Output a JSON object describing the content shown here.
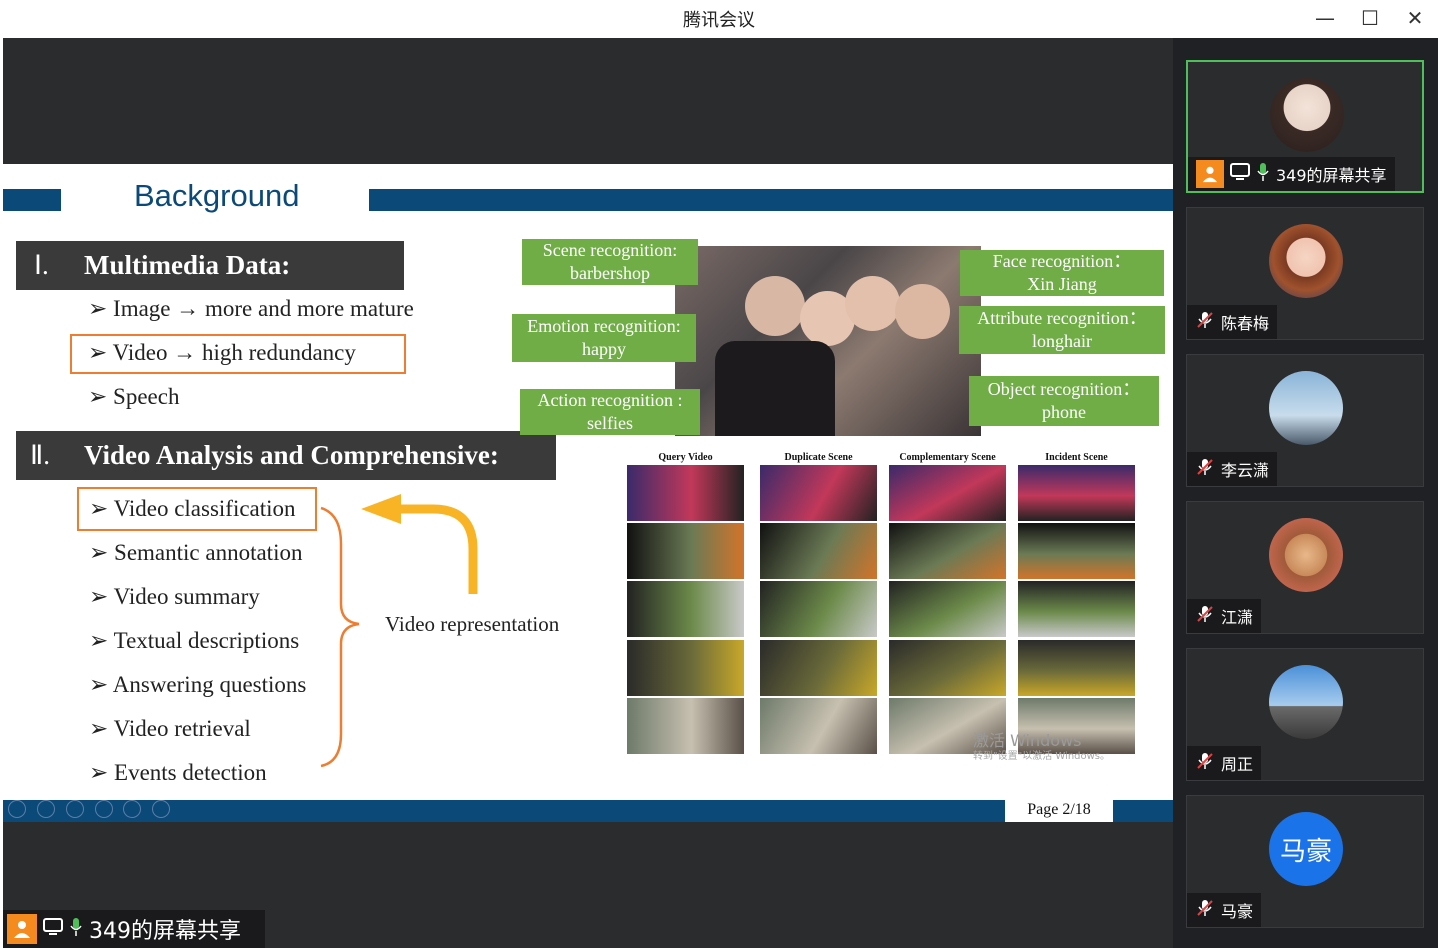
{
  "window": {
    "title": "腾讯会议",
    "minimize": "—",
    "maximize": "☐",
    "close": "✕"
  },
  "slide": {
    "title": "Background",
    "section1": {
      "numeral": "Ⅰ.",
      "heading": "Multimedia Data:"
    },
    "bullets1": [
      {
        "label": "Image",
        "arrow": "→",
        "rest": "more and more mature"
      },
      {
        "label": "Video",
        "arrow": "→",
        "rest": "high redundancy"
      },
      {
        "label": "Speech"
      }
    ],
    "section2": {
      "numeral": "Ⅱ.",
      "heading": "Video Analysis and Comprehensive:"
    },
    "bullets2": [
      "Video classification",
      "Semantic annotation",
      "Video summary",
      "Textual descriptions",
      "Answering questions",
      "Video retrieval",
      "Events detection"
    ],
    "video_representation": "Video representation",
    "labels": {
      "scene": [
        "Scene recognition:",
        "barbershop"
      ],
      "emotion": [
        "Emotion recognition:",
        "happy"
      ],
      "action": [
        "Action recognition :",
        "selfies"
      ],
      "face": [
        "Face recognition：",
        "Xin Jiang"
      ],
      "attribute": [
        "Attribute recognition：",
        "longhair"
      ],
      "object": [
        "Object recognition：",
        "phone"
      ]
    },
    "grid_headers": [
      "Query Video",
      "Duplicate Scene",
      "Complementary Scene",
      "Incident Scene"
    ],
    "page": "Page 2/18",
    "watermark": [
      "激活 Windows",
      "转到\"设置\"以激活 Windows。"
    ]
  },
  "bottom_bar": {
    "share_label": "349的屏幕共享"
  },
  "participants": [
    {
      "name": "349的屏幕共享",
      "active": true,
      "mic": "on",
      "avatar": "woman-glasses-avatar"
    },
    {
      "name": "陈春梅",
      "mic": "off",
      "avatar": "girl-cartoon-avatar"
    },
    {
      "name": "李云潇",
      "mic": "off",
      "avatar": "eiffel-tower-avatar"
    },
    {
      "name": "江潇",
      "mic": "off",
      "avatar": "monkey-avatar"
    },
    {
      "name": "周正",
      "mic": "off",
      "avatar": "windmill-photo-avatar"
    },
    {
      "name": "马豪",
      "mic": "off",
      "avatar": "initials-avatar",
      "initials": "马豪",
      "color": "#1a73e8"
    }
  ]
}
